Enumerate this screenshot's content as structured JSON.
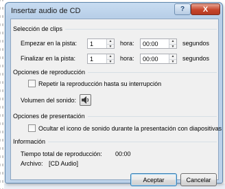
{
  "dialog": {
    "title": "Insertar audio de CD",
    "help_label": "?",
    "close_label": "X"
  },
  "clips": {
    "legend": "Selección de clips",
    "start_track_label": "Empezar en la pista:",
    "start_track_value": "1",
    "start_time_label": "hora:",
    "start_time_value": "00:00",
    "start_unit": "segundos",
    "end_track_label": "Finalizar en la pista:",
    "end_track_value": "1",
    "end_time_label": "hora:",
    "end_time_value": "00:00",
    "end_unit": "segundos"
  },
  "playback": {
    "legend": "Opciones de reproducción",
    "repeat_label": "Repetir la reproducción hasta su interrupción",
    "repeat_checked": false,
    "volume_label": "Volumen del sonido:"
  },
  "presentation": {
    "legend": "Opciones de presentación",
    "hide_icon_label": "Ocultar el icono de sonido durante la presentación con diapositivas",
    "hide_icon_checked": false
  },
  "info": {
    "legend": "Información",
    "total_time_label": "Tiempo total de reproducción:",
    "total_time_value": "00:00",
    "file_label": "Archivo:",
    "file_value": "[CD Audio]"
  },
  "buttons": {
    "accept": "Aceptar",
    "cancel": "Cancelar"
  },
  "icons": {
    "help": "help-icon",
    "close": "close-icon",
    "spin_up": "spin-up-icon",
    "spin_down": "spin-down-icon",
    "volume": "speaker-icon"
  }
}
